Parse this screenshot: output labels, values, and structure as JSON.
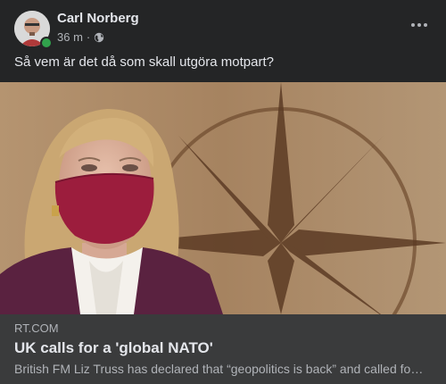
{
  "post": {
    "author": "Carl Norberg",
    "timestamp": "36 m",
    "privacy_separator": "·",
    "privacy_icon": "globe-icon",
    "more_icon": "more-horizontal-icon",
    "text": "Så vem är det då som skall utgöra motpart?"
  },
  "link": {
    "domain": "RT.COM",
    "title": "UK calls for a 'global NATO'",
    "description": "British FM Liz Truss has declared that “geopolitics is back” and called for a global NATO"
  },
  "colors": {
    "background": "#242526",
    "link_footer": "#3a3b3c",
    "text_primary": "#e4e6eb",
    "text_secondary": "#b0b3b8",
    "online": "#31a24c"
  }
}
